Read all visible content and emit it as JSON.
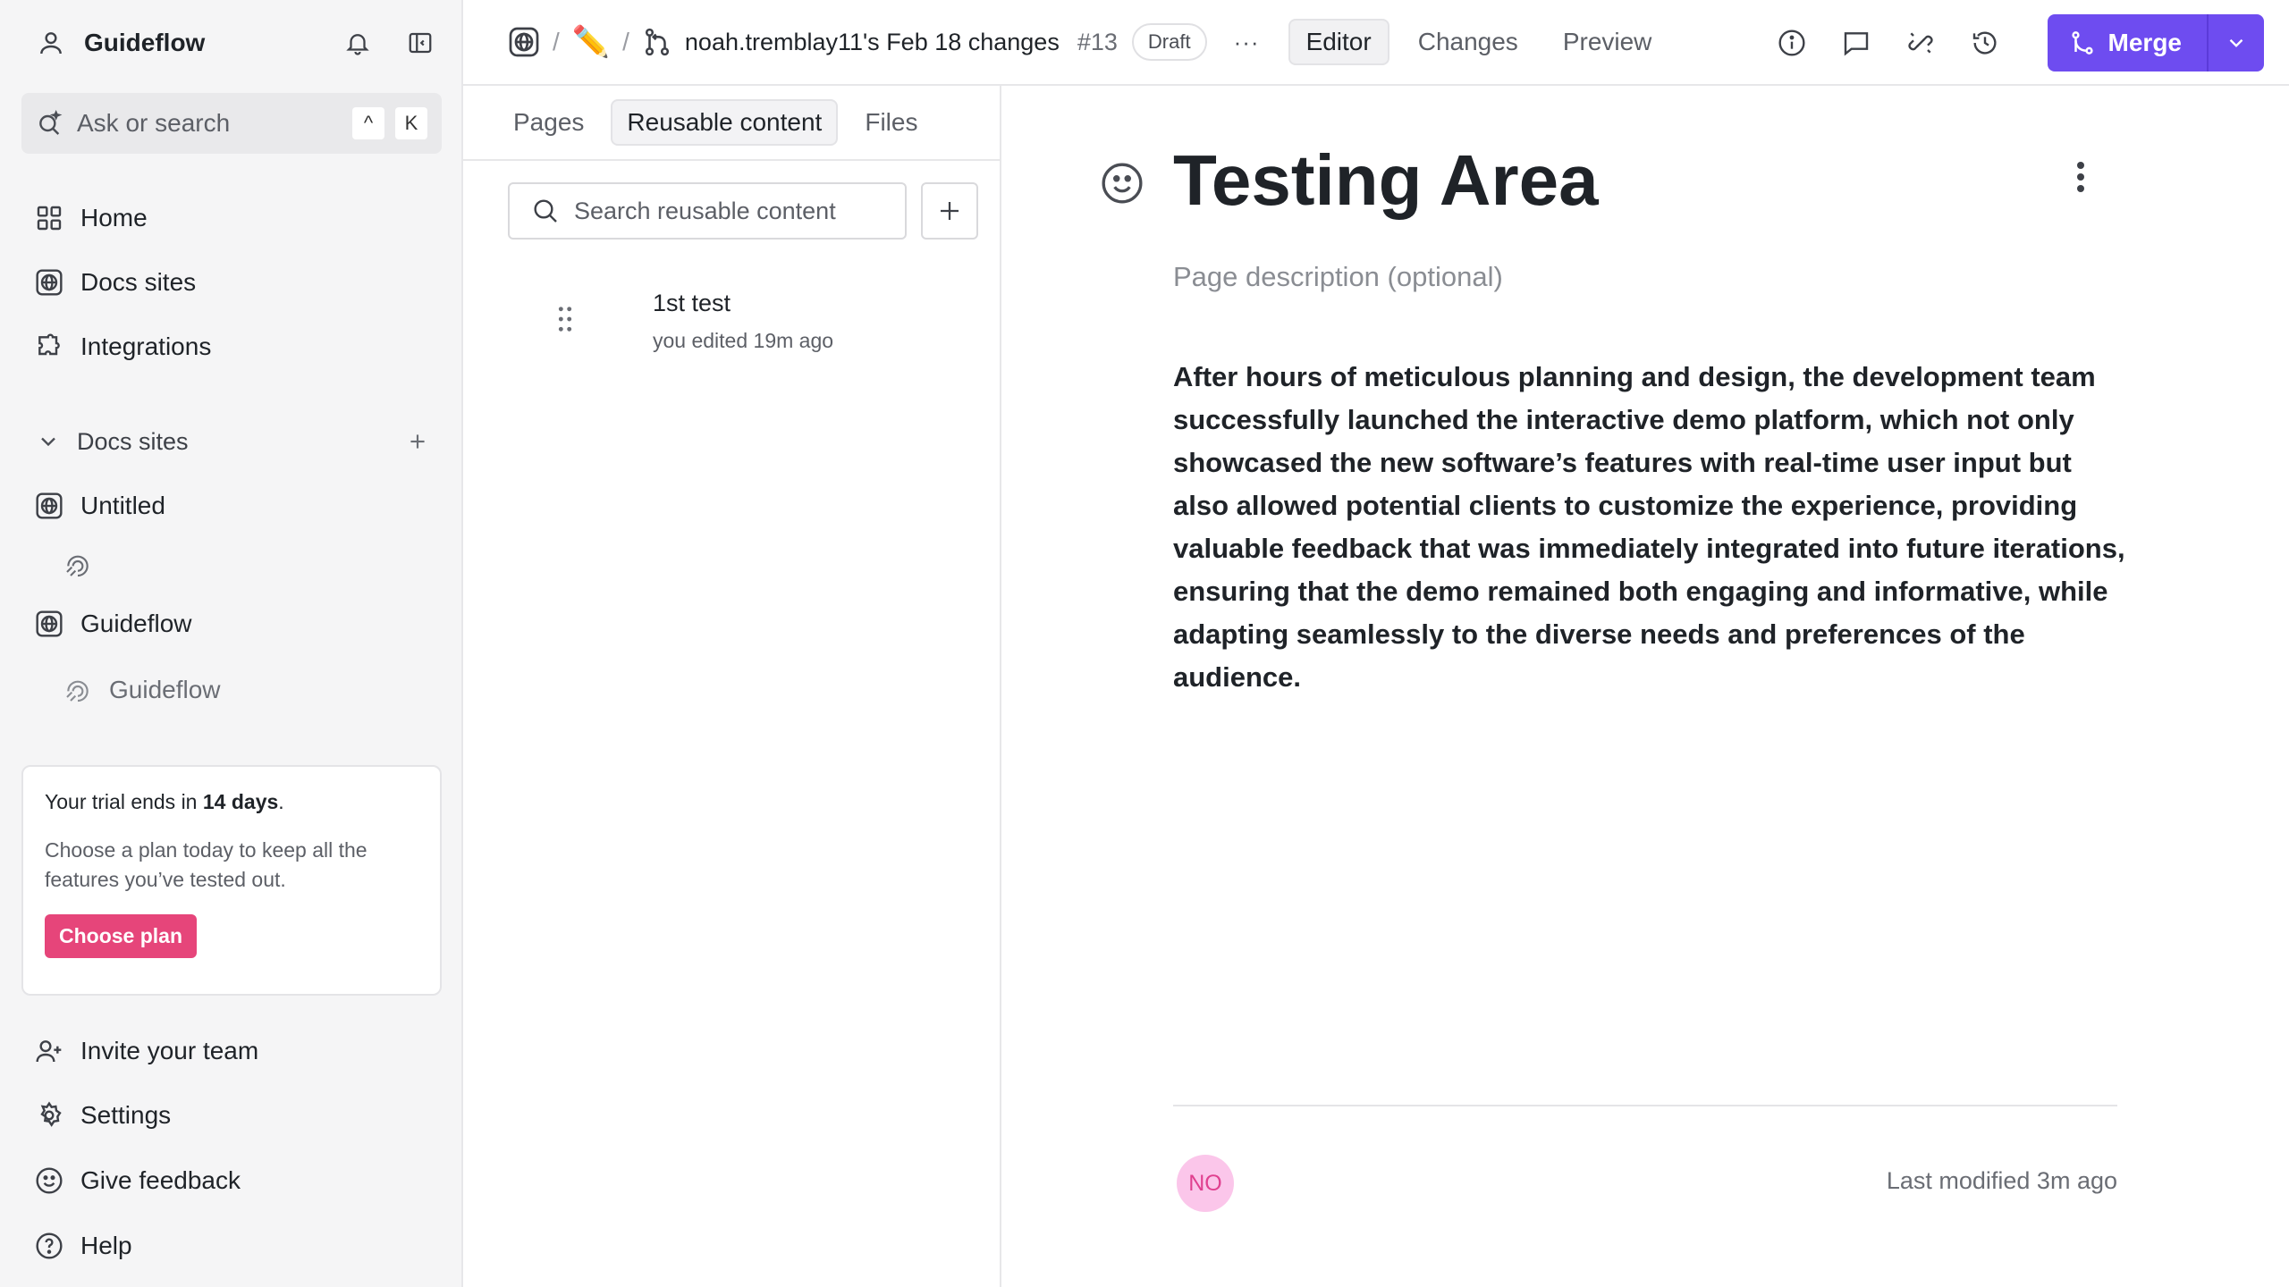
{
  "workspace": {
    "name": "Guideflow"
  },
  "search": {
    "placeholder": "Ask or search",
    "shortcut_key1": "^",
    "shortcut_key2": "K"
  },
  "nav": {
    "home": "Home",
    "docs_sites": "Docs sites",
    "integrations": "Integrations"
  },
  "docs_section": {
    "title": "Docs sites",
    "sites": [
      {
        "label": "Untitled"
      },
      {
        "label": "Guideflow",
        "child_label": "Guideflow"
      }
    ]
  },
  "trial": {
    "prefix": "Your trial ends in ",
    "days": "14 days",
    "suffix": ".",
    "message": "Choose a plan today to keep all the features you’ve tested out.",
    "button": "Choose plan"
  },
  "bottom_nav": {
    "invite": "Invite your team",
    "settings": "Settings",
    "feedback": "Give feedback",
    "help": "Help"
  },
  "topbar": {
    "sep": "/",
    "emoji": "✏️",
    "branch_title": "noah.tremblay11's Feb 18 changes",
    "pr_number": "#13",
    "status": "Draft",
    "more": "···",
    "modes": [
      "Editor",
      "Changes",
      "Preview"
    ],
    "active_mode": "Editor",
    "merge_label": "Merge",
    "accent": "#6e4cf0"
  },
  "mid": {
    "tabs": [
      "Pages",
      "Reusable content",
      "Files"
    ],
    "search_placeholder": "Search reusable content",
    "items": [
      {
        "title": "1st test",
        "meta": "you edited 19m ago"
      }
    ]
  },
  "editor": {
    "title": "Testing Area",
    "description_placeholder": "Page description (optional)",
    "body": "After hours of meticulous planning and design, the development team successfully launched the interactive demo platform, which not only showcased the new software’s features with real-time user input but also allowed potential clients to customize the experience, providing valuable feedback that was immediately integrated into future iterations, ensuring that the demo remained both engaging and informative, while adapting seamlessly to the diverse needs and preferences of the audience.",
    "avatar_initials": "NO",
    "last_modified": "Last modified 3m ago"
  }
}
